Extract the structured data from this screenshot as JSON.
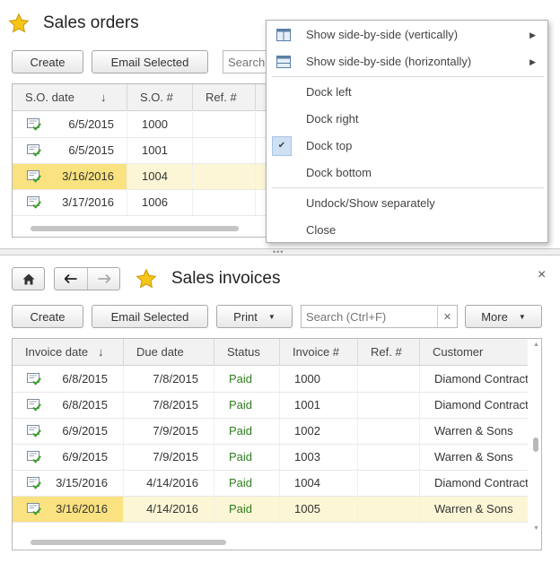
{
  "colors": {
    "accent_star": "#f2c21a",
    "selected_row": "#fcf6d6",
    "selected_cell": "#f9e27f",
    "paid_status": "#2e7d1e"
  },
  "sales_orders": {
    "title": "Sales orders",
    "toolbar": {
      "create_label": "Create",
      "email_selected_label": "Email Selected",
      "search_placeholder": "Search (Ctrl+F)"
    },
    "columns": {
      "so_date": "S.O. date",
      "so_number": "S.O. #",
      "ref": "Ref. #"
    },
    "sort_arrow": "↓",
    "rows": [
      {
        "icon": "posted-document-icon",
        "date": "6/5/2015",
        "number": "1000",
        "ref": ""
      },
      {
        "icon": "posted-document-icon",
        "date": "6/5/2015",
        "number": "1001",
        "ref": ""
      },
      {
        "icon": "posted-document-icon",
        "date": "3/16/2016",
        "number": "1004",
        "ref": "",
        "selected": true
      },
      {
        "icon": "posted-document-icon",
        "date": "3/17/2016",
        "number": "1006",
        "ref": ""
      }
    ]
  },
  "context_menu": {
    "items": [
      {
        "label": "Show side-by-side (vertically)",
        "icon": "split-vertical-icon",
        "submenu": true
      },
      {
        "label": "Show side-by-side (horizontally)",
        "icon": "split-horizontal-icon",
        "submenu": true
      },
      {
        "label": "Dock left"
      },
      {
        "label": "Dock right"
      },
      {
        "label": "Dock top",
        "checked": true
      },
      {
        "label": "Dock bottom"
      },
      {
        "label": "Undock/Show separately"
      },
      {
        "label": "Close"
      }
    ]
  },
  "sales_invoices": {
    "title": "Sales invoices",
    "toolbar": {
      "create_label": "Create",
      "email_selected_label": "Email Selected",
      "print_label": "Print",
      "search_placeholder": "Search (Ctrl+F)",
      "more_label": "More"
    },
    "columns": {
      "invoice_date": "Invoice date",
      "due_date": "Due date",
      "status": "Status",
      "invoice_number": "Invoice #",
      "ref": "Ref. #",
      "customer": "Customer"
    },
    "sort_arrow": "↓",
    "rows": [
      {
        "icon": "posted-document-icon",
        "invoice_date": "6/8/2015",
        "due_date": "7/8/2015",
        "status": "Paid",
        "number": "1000",
        "ref": "",
        "customer": "Diamond Contract"
      },
      {
        "icon": "posted-document-icon",
        "invoice_date": "6/8/2015",
        "due_date": "7/8/2015",
        "status": "Paid",
        "number": "1001",
        "ref": "",
        "customer": "Diamond Contract"
      },
      {
        "icon": "posted-document-icon",
        "invoice_date": "6/9/2015",
        "due_date": "7/9/2015",
        "status": "Paid",
        "number": "1002",
        "ref": "",
        "customer": "Warren & Sons"
      },
      {
        "icon": "posted-document-icon",
        "invoice_date": "6/9/2015",
        "due_date": "7/9/2015",
        "status": "Paid",
        "number": "1003",
        "ref": "",
        "customer": "Warren & Sons"
      },
      {
        "icon": "posted-document-icon",
        "invoice_date": "3/15/2016",
        "due_date": "4/14/2016",
        "status": "Paid",
        "number": "1004",
        "ref": "",
        "customer": "Diamond Contract"
      },
      {
        "icon": "posted-document-icon",
        "invoice_date": "3/16/2016",
        "due_date": "4/14/2016",
        "status": "Paid",
        "number": "1005",
        "ref": "",
        "customer": "Warren & Sons",
        "selected": true
      }
    ]
  }
}
